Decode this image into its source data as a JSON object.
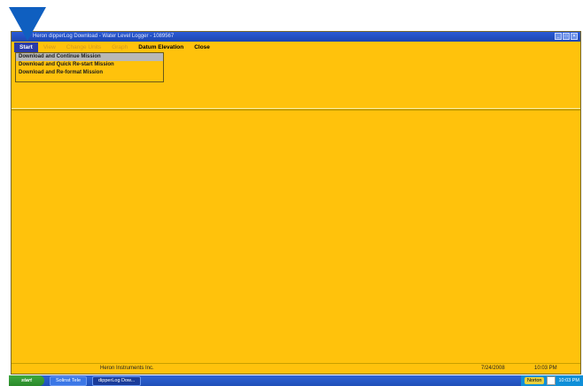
{
  "window": {
    "title": "Heron dipperLog Download - Water Level Logger - 1089567",
    "controls": [
      "_",
      "□",
      "✕"
    ]
  },
  "menu": {
    "items": [
      {
        "label": "Start",
        "state": "active"
      },
      {
        "label": "View",
        "state": "disabled"
      },
      {
        "label": "Change Units",
        "state": "disabled"
      },
      {
        "label": "Graph",
        "state": "disabled"
      },
      {
        "label": "Datum Elevation",
        "state": "enabled"
      },
      {
        "label": "Close",
        "state": "enabled"
      }
    ],
    "start_dropdown": [
      {
        "label": "Download and Continue Mission",
        "selected": true
      },
      {
        "label": "Download and Quick Re-start Mission",
        "selected": false
      },
      {
        "label": "Download and Re-format Mission",
        "selected": false
      }
    ]
  },
  "status": {
    "company": "Heron Instruments Inc.",
    "date": "7/24/2008",
    "time": "10:03 PM"
  },
  "taskbar": {
    "start_label": "start",
    "tasks": [
      "Solinst Tele",
      "dipperLog Dow..."
    ],
    "tray_label": "Norton",
    "clock": "10:03 PM"
  },
  "colors": {
    "app_background": "#ffc20c",
    "titlebar": "#2a5bd6",
    "pointer": "#0f5fc0"
  }
}
